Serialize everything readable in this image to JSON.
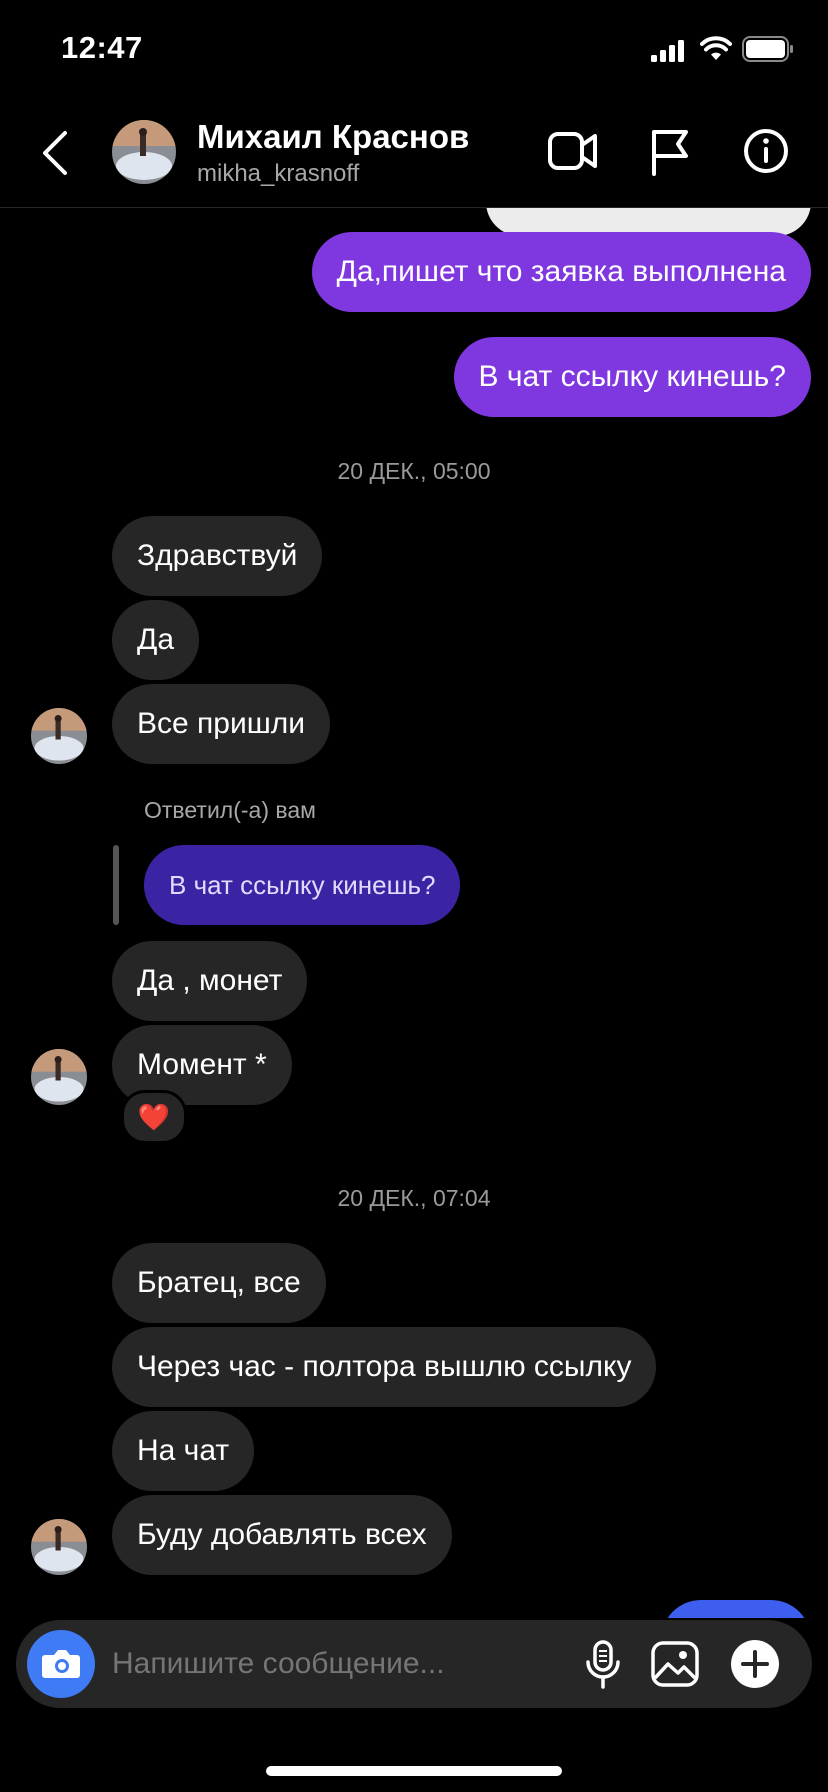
{
  "status_bar": {
    "time": "12:47"
  },
  "header": {
    "name": "Михаил Краснов",
    "username": "mikha_krasnoff"
  },
  "messages": {
    "out_1": "Да,пишет что заявка выполнена",
    "out_2": "В чат ссылку кинешь?",
    "timestamp_1": "20 ДЕК., 05:00",
    "in_1": "Здравствуй",
    "in_2": "Да",
    "in_3": "Все пришли",
    "reply_label": "Ответил(-а) вам",
    "reply_quote": "В чат ссылку кинешь?",
    "in_4": "Да , монет",
    "in_5": "Момент *",
    "reaction": "❤️",
    "timestamp_2": "20 ДЕК., 07:04",
    "in_6": "Братец, все",
    "in_7": "Через час - полтора вышлю ссылку",
    "in_8": "На чат",
    "in_9": "Буду добавлять всех"
  },
  "composer": {
    "placeholder": "Напишите сообщение..."
  },
  "colors": {
    "outgoing_bubble": "#7f38e0",
    "incoming_bubble": "#262626",
    "quoted_bubble": "#3c23a4",
    "camera_button": "#3e7bf5"
  }
}
